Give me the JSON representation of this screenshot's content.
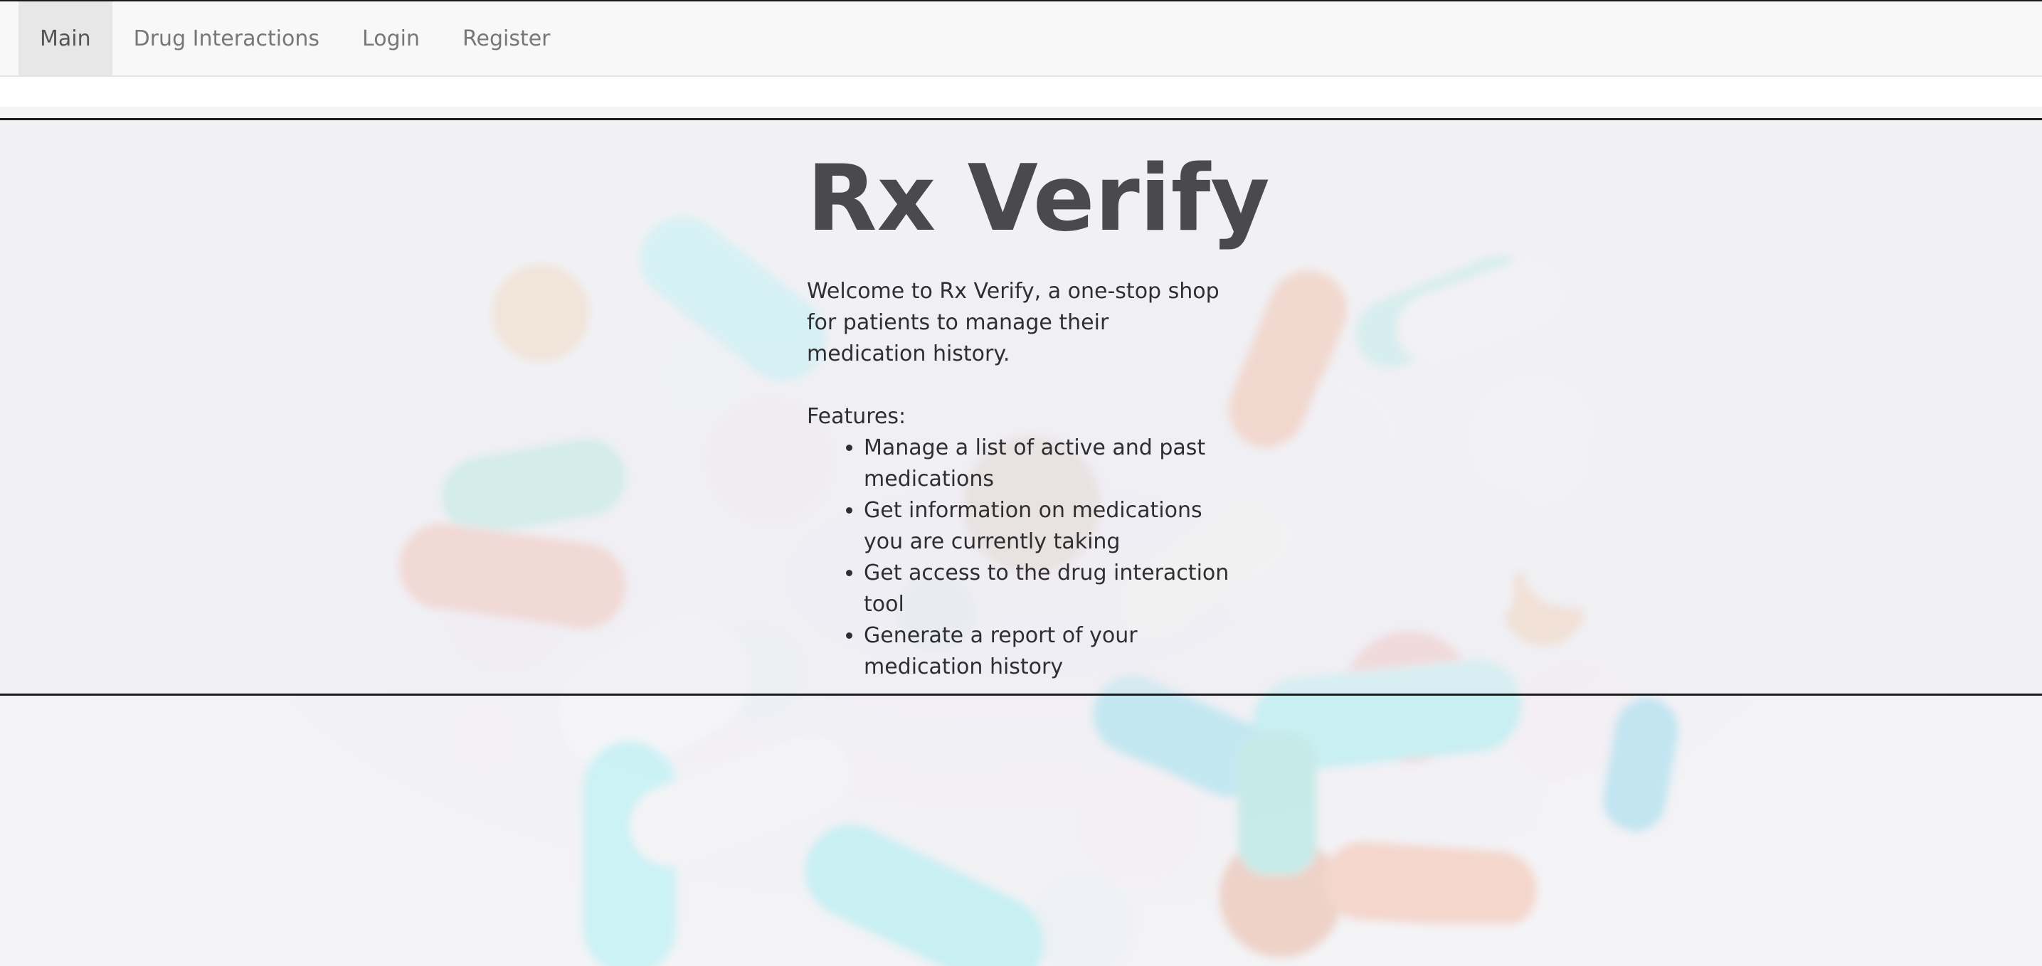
{
  "nav": {
    "items": [
      {
        "label": "Main",
        "active": true
      },
      {
        "label": "Drug Interactions",
        "active": false
      },
      {
        "label": "Login",
        "active": false
      },
      {
        "label": "Register",
        "active": false
      }
    ]
  },
  "hero": {
    "title": "Rx Verify",
    "welcome": "Welcome to Rx Verify, a one-stop shop for patients to manage their medication history.",
    "features_label": "Features:",
    "features": [
      "Manage a list of active and past medications",
      "Get information on medications you are currently taking",
      "Get access to the drug interaction tool",
      "Generate a report of your medication history"
    ]
  },
  "colors": {
    "nav_bg": "#f8f8f8",
    "nav_active_bg": "#e7e7e7",
    "nav_text": "#777777",
    "title_text": "#4a4a4c",
    "band_border": "#1c1c1c"
  }
}
